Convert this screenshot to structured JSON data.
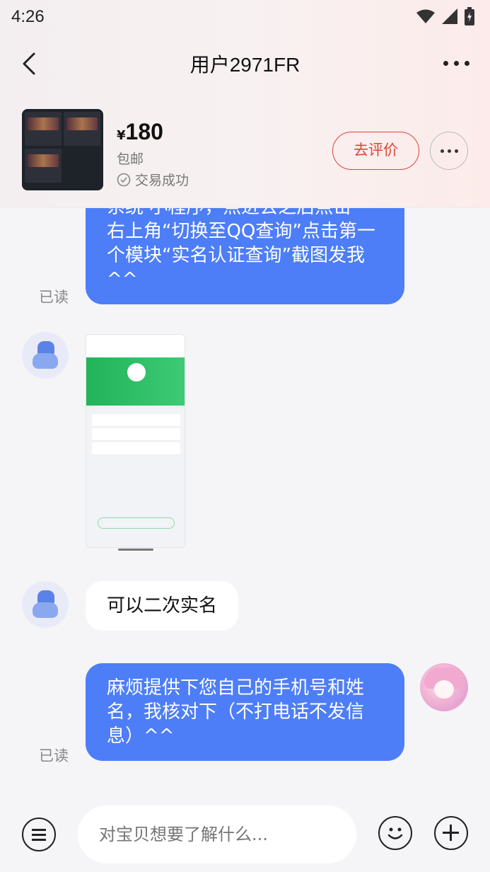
{
  "status_bar": {
    "time": "4:26"
  },
  "header": {
    "title": "用户2971FR"
  },
  "product": {
    "currency": "¥",
    "price": "180",
    "shipping": "包邮",
    "trade_status": "交易成功",
    "review_label": "去评价"
  },
  "messages": [
    {
      "direction": "out",
      "text": "右上角“切换至QQ查询”点击第一个模块“实名认证查询”截图发我^^",
      "partial_top_line": "系统 小程序，点进去之后点击",
      "read_label": "已读"
    },
    {
      "direction": "in",
      "type": "image"
    },
    {
      "direction": "in",
      "text": "可以二次实名"
    },
    {
      "direction": "out",
      "text": "麻烦提供下您自己的手机号和姓名，我核对下（不打电话不发信息）^^",
      "read_label": "已读"
    }
  ],
  "input": {
    "placeholder": "对宝贝想要了解什么..."
  },
  "icons": [
    "back-arrow-icon",
    "more-dots-icon",
    "check-circle-icon",
    "menu-icon",
    "emoji-icon",
    "plus-icon",
    "wifi-icon",
    "signal-icon",
    "battery-icon"
  ],
  "colors": {
    "accent_blue": "#4d7ef7",
    "review_red": "#e0453a"
  }
}
